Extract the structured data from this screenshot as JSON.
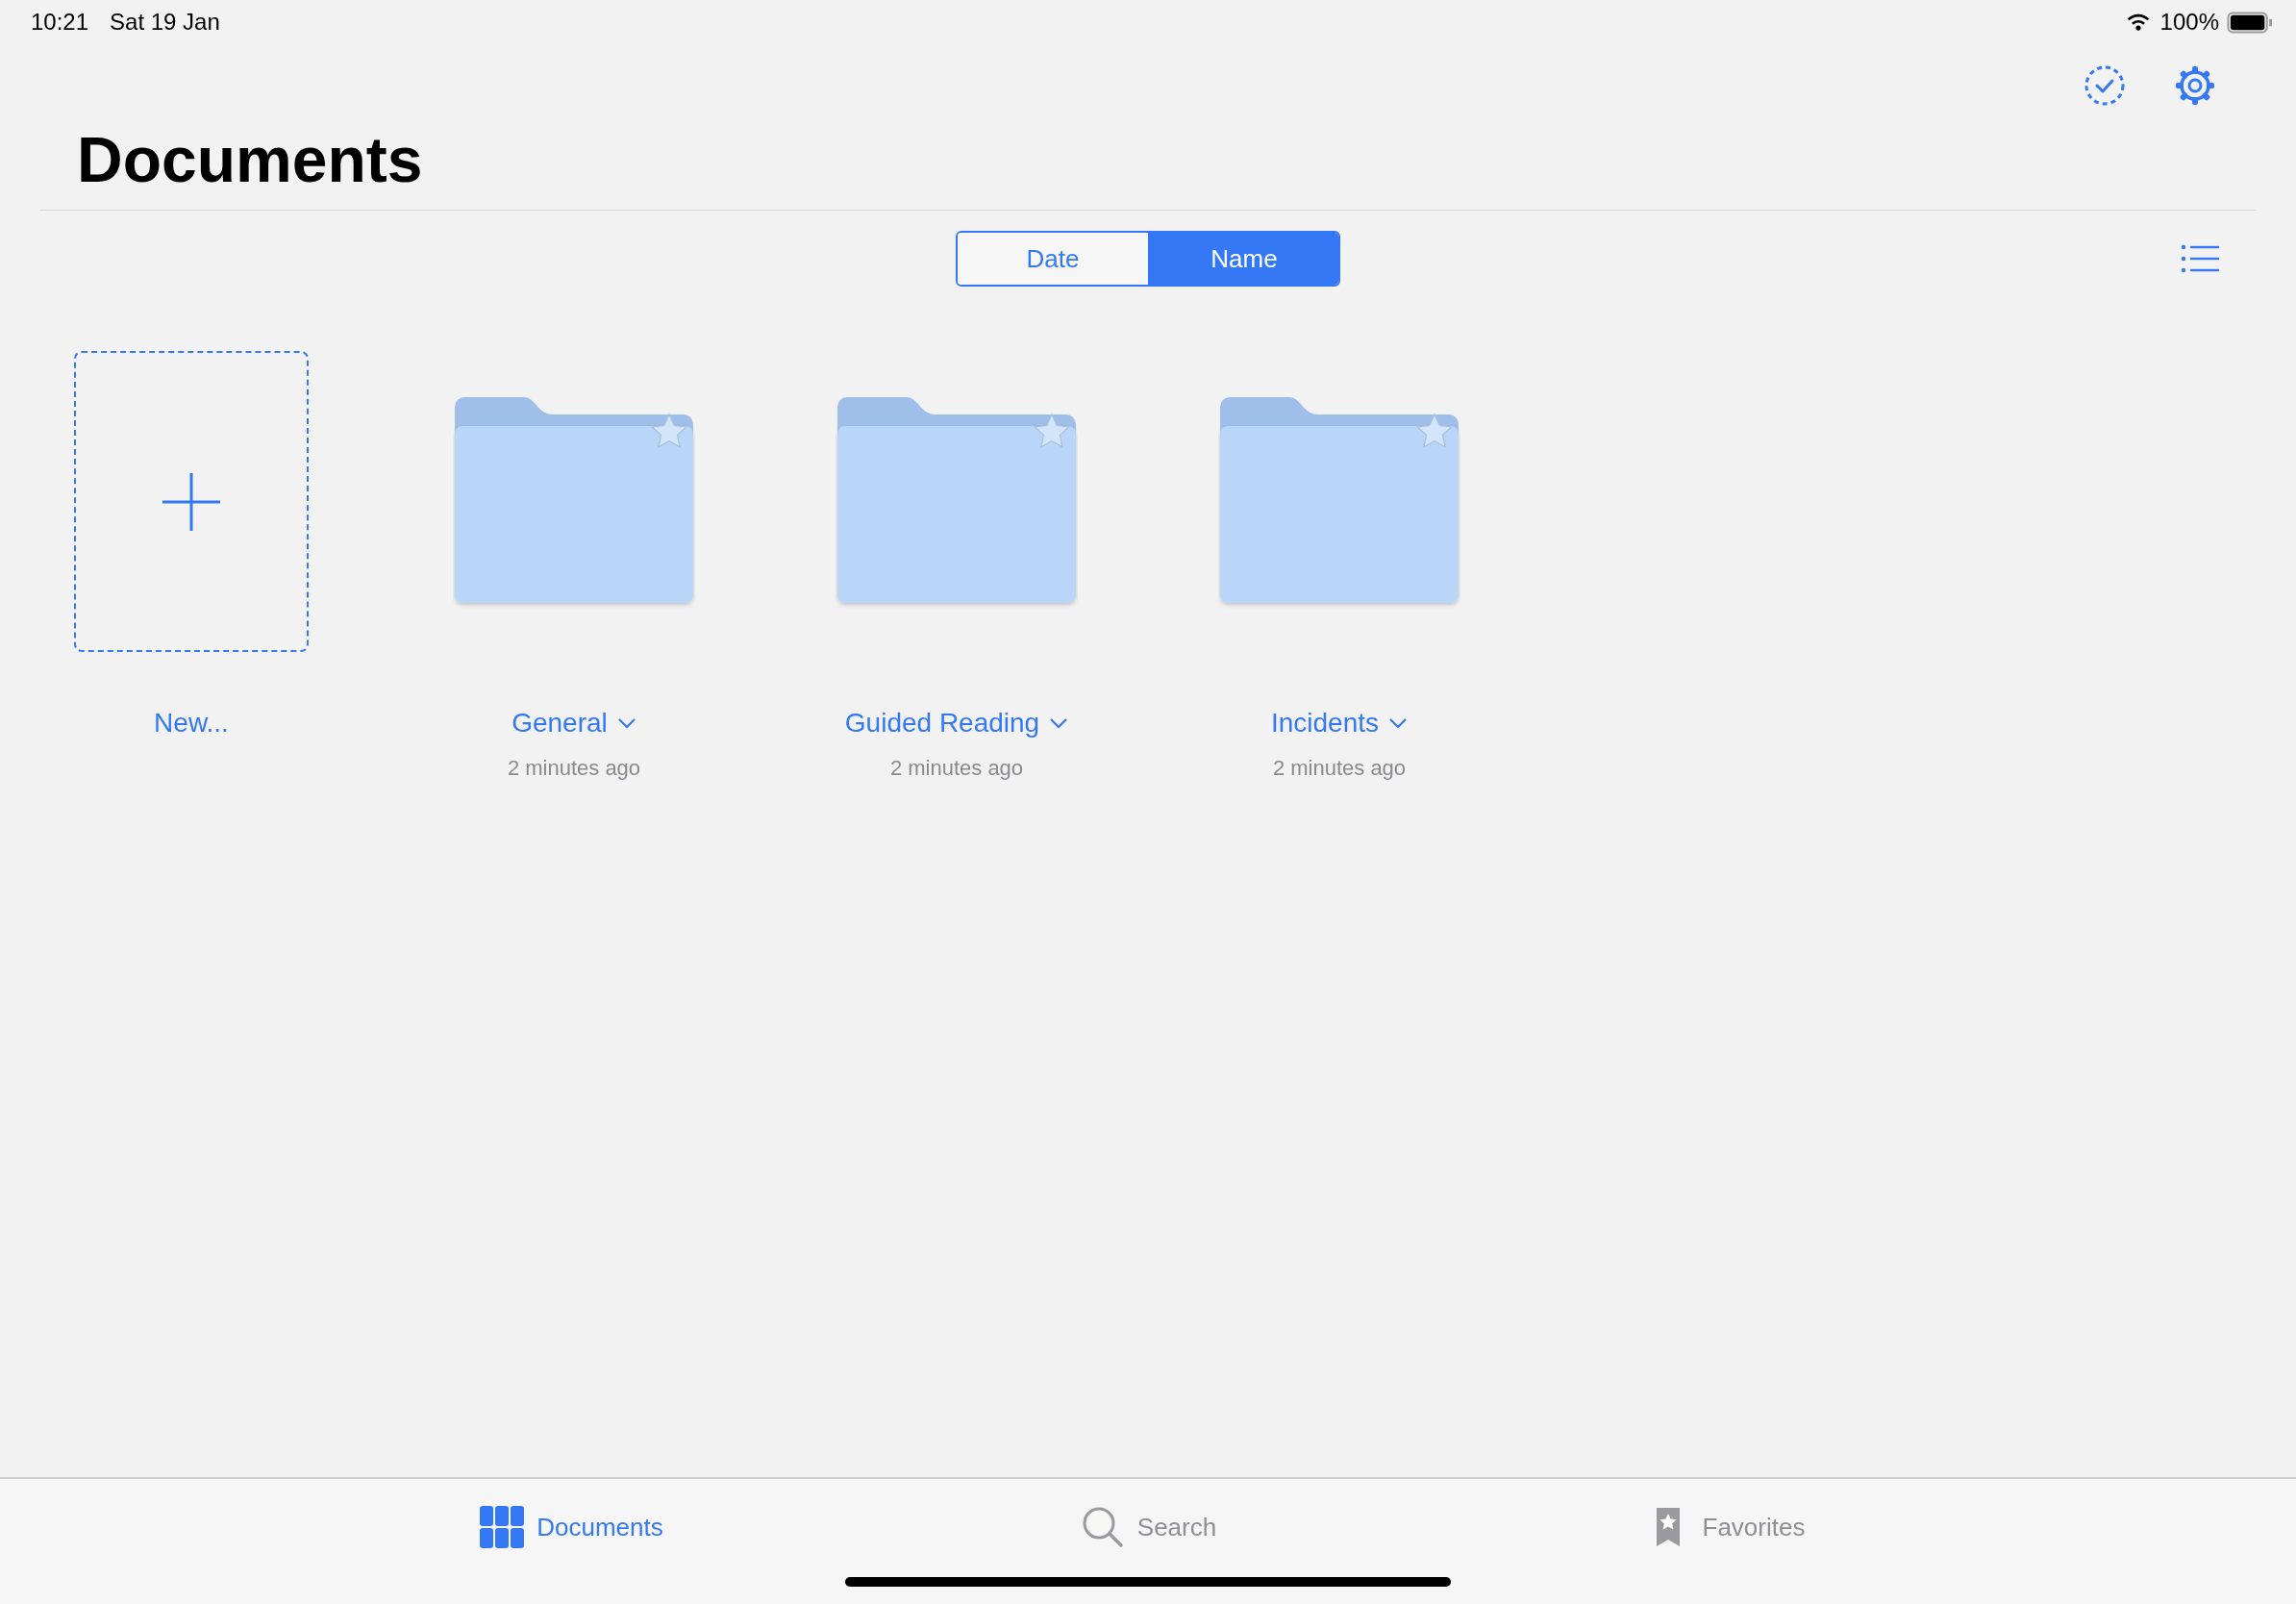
{
  "status_bar": {
    "time": "10:21",
    "date": "Sat 19 Jan",
    "battery": "100%"
  },
  "title": "Documents",
  "sort": [
    {
      "label": "Date",
      "selected": false
    },
    {
      "label": "Name",
      "selected": true
    }
  ],
  "items": [
    {
      "kind": "new",
      "name": "New..."
    },
    {
      "kind": "folder",
      "name": "General",
      "subtitle": "2 minutes ago",
      "favorite": false
    },
    {
      "kind": "folder",
      "name": "Guided Reading",
      "subtitle": "2 minutes ago",
      "favorite": false
    },
    {
      "kind": "folder",
      "name": "Incidents",
      "subtitle": "2 minutes ago",
      "favorite": false
    }
  ],
  "tab_bar": [
    {
      "kind": "documents",
      "label": "Documents",
      "selected": true
    },
    {
      "kind": "search",
      "label": "Search",
      "selected": false
    },
    {
      "kind": "favorites",
      "label": "Favorites",
      "selected": false
    }
  ]
}
